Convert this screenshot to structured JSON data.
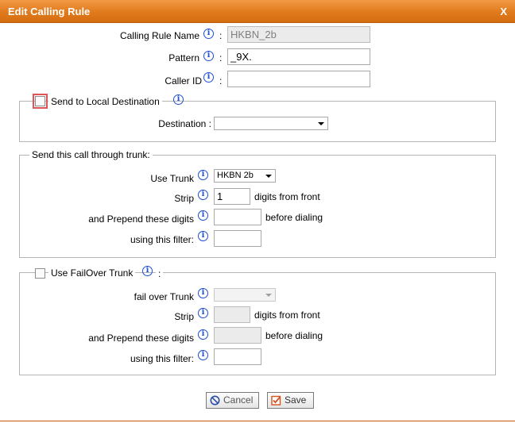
{
  "dialog": {
    "title": "Edit Calling Rule",
    "close_label": "X"
  },
  "info_glyph": "i",
  "colon": ":",
  "rule": {
    "name_label": "Calling Rule Name",
    "name_value": "HKBN_2b",
    "pattern_label": "Pattern",
    "pattern_value": "_9X.",
    "callerid_label": "Caller ID",
    "callerid_value": ""
  },
  "local_dest": {
    "legend": "Send to Local Destination",
    "destination_label": "Destination :",
    "destination_value": ""
  },
  "trunk": {
    "legend": "Send this call through trunk:",
    "use_trunk_label": "Use Trunk",
    "use_trunk_value": "HKBN 2b",
    "strip_label": "Strip",
    "strip_value": "1",
    "strip_suffix": "digits from front",
    "prepend_label": "and Prepend these digits",
    "prepend_value": "",
    "prepend_suffix": "before dialing",
    "filter_label": "using this filter:",
    "filter_value": ""
  },
  "failover": {
    "legend": "Use FailOver Trunk",
    "legend_colon": ":",
    "trunk_label": "fail over Trunk",
    "trunk_value": "",
    "strip_label": "Strip",
    "strip_value": "",
    "strip_suffix": "digits from front",
    "prepend_label": "and Prepend these digits",
    "prepend_value": "",
    "prepend_suffix": "before dialing",
    "filter_label": "using this filter:",
    "filter_value": ""
  },
  "buttons": {
    "cancel": "Cancel",
    "save": "Save"
  },
  "colors": {
    "accent": "#e07a1c",
    "info": "#1f4fd6",
    "cancel_icon": "#2b4ea8",
    "save_icon": "#d4501e"
  }
}
